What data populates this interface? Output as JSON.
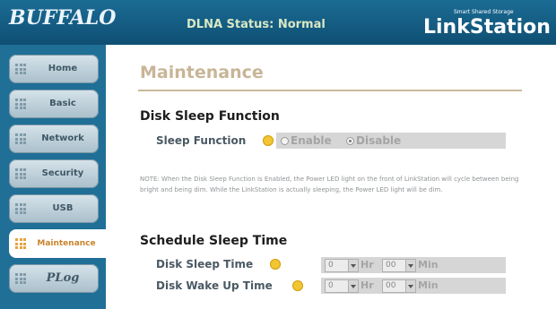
{
  "header": {
    "brand": "BUFFALO",
    "status": "DLNA Status: Normal",
    "product_tagline": "Smart Shared Storage",
    "product_name": "LinkStation"
  },
  "sidebar": {
    "items": [
      {
        "label": "Home"
      },
      {
        "label": "Basic"
      },
      {
        "label": "Network"
      },
      {
        "label": "Security"
      },
      {
        "label": "USB"
      },
      {
        "label": "Maintenance"
      },
      {
        "label": "PLog"
      }
    ],
    "active": "Maintenance"
  },
  "main": {
    "title": "Maintenance",
    "disk_sleep": {
      "heading": "Disk Sleep Function",
      "field_label": "Sleep Function",
      "options": [
        "Enable",
        "Disable"
      ],
      "selected": "Disable"
    },
    "note": "NOTE: When the Disk Sleep Function is Enabled, the Power LED light on the front of LinkStation will cycle between being bright and being dim. While the LinkStation is actually sleeping, the Power LED light will be dim.",
    "schedule": {
      "heading": "Schedule Sleep Time",
      "sleep_time": {
        "label": "Disk Sleep Time",
        "hr": "0",
        "min": "00",
        "hr_unit": "Hr",
        "min_unit": "Min"
      },
      "wake_time": {
        "label": "Disk Wake Up Time",
        "hr": "0",
        "min": "00",
        "hr_unit": "Hr",
        "min_unit": "Min"
      }
    }
  },
  "colors": {
    "header": "#135f86",
    "sidebar": "#1f6f97",
    "accent": "#e8a23b",
    "title": "#c8b597"
  }
}
